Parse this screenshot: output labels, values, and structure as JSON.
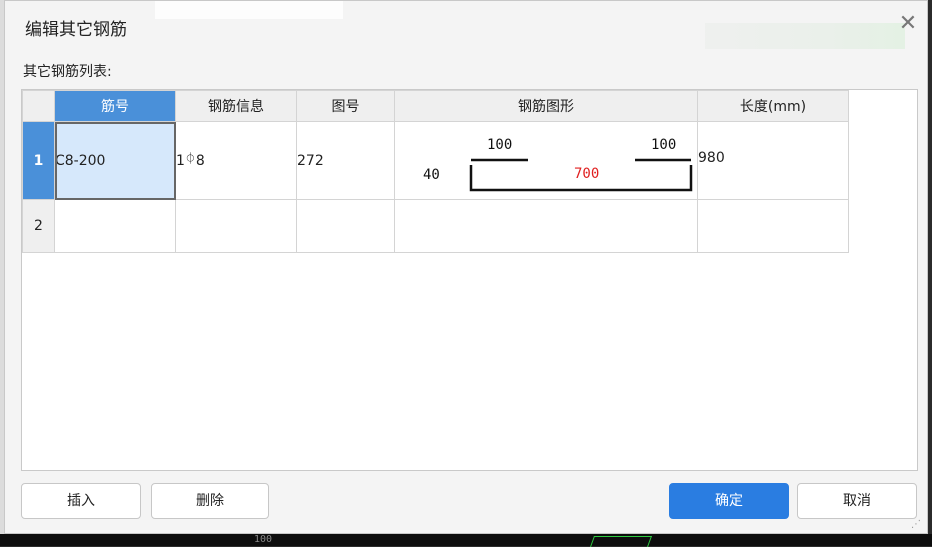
{
  "dialog": {
    "title": "编辑其它钢筋",
    "close_glyph": "✕",
    "list_label": "其它钢筋列表:"
  },
  "grid": {
    "columns": [
      "筋号",
      "钢筋信息",
      "图号",
      "钢筋图形",
      "长度(mm)"
    ],
    "rows": [
      {
        "num": "1",
        "bar_no": "C8-200",
        "info_count": "1",
        "info_grade_symbol": "⏀",
        "info_diameter": "8",
        "fig_no": "272",
        "shape": {
          "left_label": "40",
          "left_top_label": "100",
          "right_top_label": "100",
          "bottom_label": "700"
        },
        "length": "980"
      },
      {
        "num": "2",
        "bar_no": "",
        "info_count": "",
        "info_grade_symbol": "",
        "info_diameter": "",
        "fig_no": "",
        "length": ""
      }
    ]
  },
  "buttons": {
    "insert": "插入",
    "delete": "删除",
    "ok": "确定",
    "cancel": "取消"
  },
  "background": {
    "ruler_text": "100"
  },
  "colors": {
    "accent": "#2a7de1",
    "header_active": "#4a90d9",
    "shape_dimension_red": "#e02020"
  }
}
